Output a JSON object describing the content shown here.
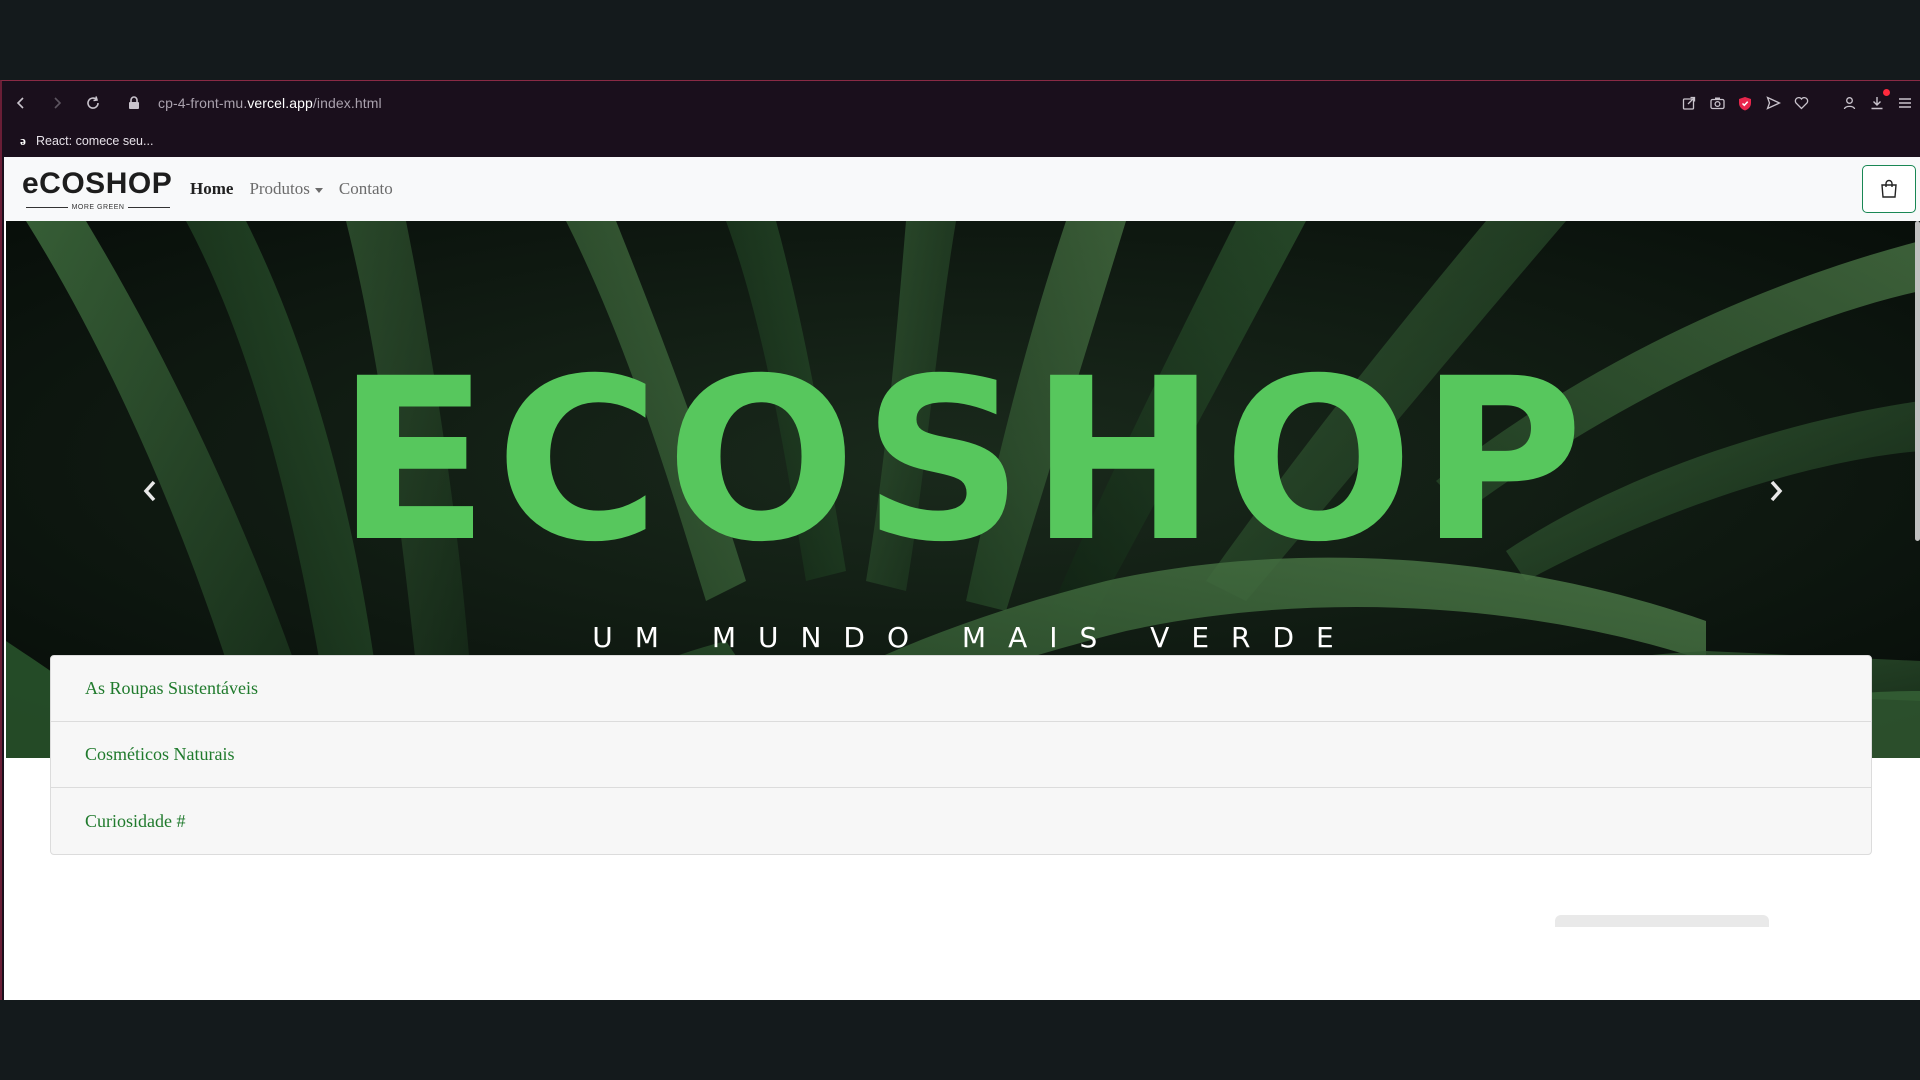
{
  "browser": {
    "url_prefix": "cp-4-front-mu.",
    "url_host": "vercel.app",
    "url_path": "/index.html",
    "bookmark_label": "React: comece seu..."
  },
  "navbar": {
    "logo_text": "eCOSHOP",
    "logo_subtitle": "MORE GREEN",
    "links": {
      "home": "Home",
      "produtos": "Produtos",
      "contato": "Contato"
    }
  },
  "hero": {
    "title": "ECOSHOP",
    "subtitle": "UM MUNDO MAIS VERDE",
    "prev_label": "‹",
    "next_label": "›",
    "active_slide": 1,
    "slide_count": 3
  },
  "accordion": {
    "items": [
      {
        "label": "As Roupas Sustentáveis"
      },
      {
        "label": "Cosméticos Naturais"
      },
      {
        "label": "Curiosidade #"
      }
    ]
  },
  "colors": {
    "brand_green": "#57c75d",
    "link_green": "#1f7a2c",
    "browser_chrome": "#1a0f1c",
    "accent_red": "#e8264c"
  }
}
